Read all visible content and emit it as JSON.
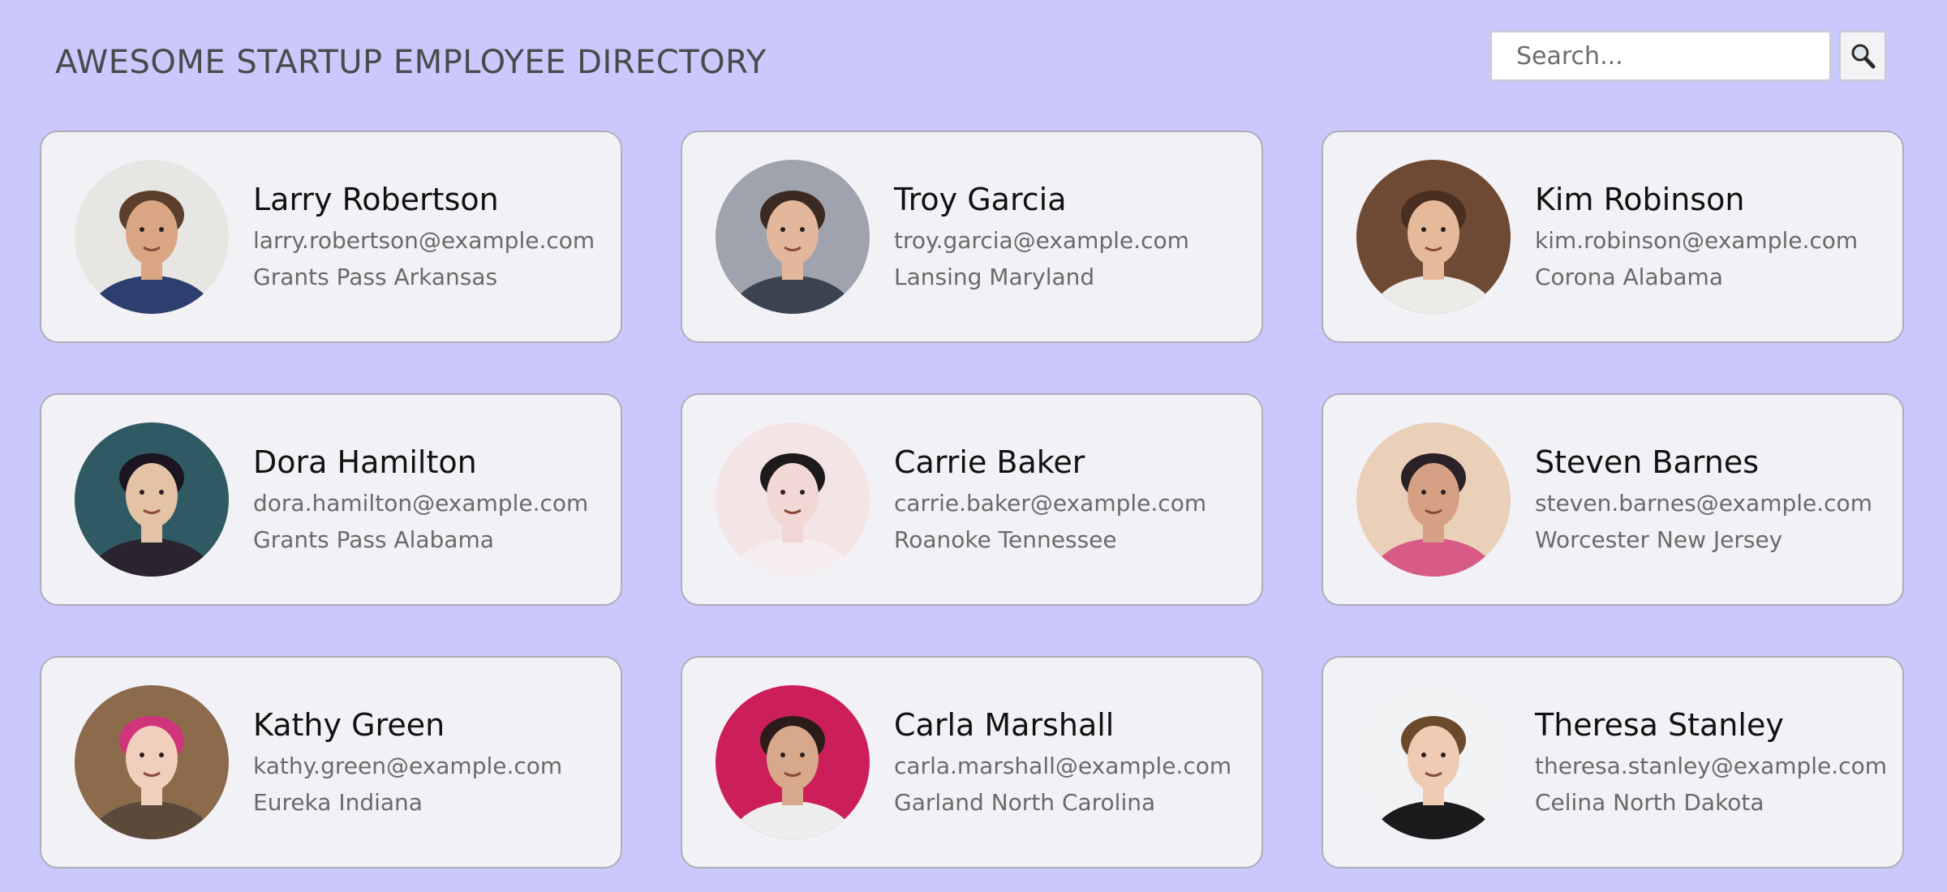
{
  "header": {
    "title": "AWESOME STARTUP EMPLOYEE DIRECTORY",
    "search_placeholder": "Search...",
    "search_button_icon": "search-icon"
  },
  "colors": {
    "background": "#cbc8fe",
    "card": "#f2f1f6",
    "card_border": "#aeadb8",
    "name_text": "#111111",
    "detail_text": "#6a6a6a"
  },
  "employees": [
    {
      "name": "Larry Robertson",
      "email": "larry.robertson@example.com",
      "location": "Grants Pass Arkansas",
      "avatar": {
        "bg": "#e8e6e2",
        "skin": "#d9a582",
        "hair": "#5b3e2b",
        "shirt": "#2c3f6e"
      }
    },
    {
      "name": "Troy Garcia",
      "email": "troy.garcia@example.com",
      "location": "Lansing Maryland",
      "avatar": {
        "bg": "#9ea3ad",
        "skin": "#e3b79c",
        "hair": "#3a2a22",
        "shirt": "#3c4452"
      }
    },
    {
      "name": "Kim Robinson",
      "email": "kim.robinson@example.com",
      "location": "Corona Alabama",
      "avatar": {
        "bg": "#6e4a34",
        "skin": "#e6b99b",
        "hair": "#4a2e1f",
        "shirt": "#ecebe8"
      }
    },
    {
      "name": "Dora Hamilton",
      "email": "dora.hamilton@example.com",
      "location": "Grants Pass Alabama",
      "avatar": {
        "bg": "#2f5a63",
        "skin": "#e3c2a6",
        "hair": "#1c1420",
        "shirt": "#2a2430"
      }
    },
    {
      "name": "Carrie Baker",
      "email": "carrie.baker@example.com",
      "location": "Roanoke Tennessee",
      "avatar": {
        "bg": "#f3e5e6",
        "skin": "#f2d8d4",
        "hair": "#1d1a1c",
        "shirt": "#f6eeee"
      }
    },
    {
      "name": "Steven Barnes",
      "email": "steven.barnes@example.com",
      "location": "Worcester New Jersey",
      "avatar": {
        "bg": "#eacfb9",
        "skin": "#d6a085",
        "hair": "#2a2226",
        "shirt": "#d85a86"
      }
    },
    {
      "name": "Kathy Green",
      "email": "kathy.green@example.com",
      "location": "Eureka Indiana",
      "avatar": {
        "bg": "#8c6a4c",
        "skin": "#f0cfbc",
        "hair": "#d0347a",
        "shirt": "#5b4a3c"
      }
    },
    {
      "name": "Carla Marshall",
      "email": "carla.marshall@example.com",
      "location": "Garland North Carolina",
      "avatar": {
        "bg": "#cc1f5a",
        "skin": "#d8a88a",
        "hair": "#2b1c1a",
        "shirt": "#eeeeee"
      }
    },
    {
      "name": "Theresa Stanley",
      "email": "theresa.stanley@example.com",
      "location": "Celina North Dakota",
      "avatar": {
        "bg": "#f1f2f4",
        "skin": "#f0cbb3",
        "hair": "#6b4a2c",
        "shirt": "#1c1a1c"
      }
    }
  ]
}
